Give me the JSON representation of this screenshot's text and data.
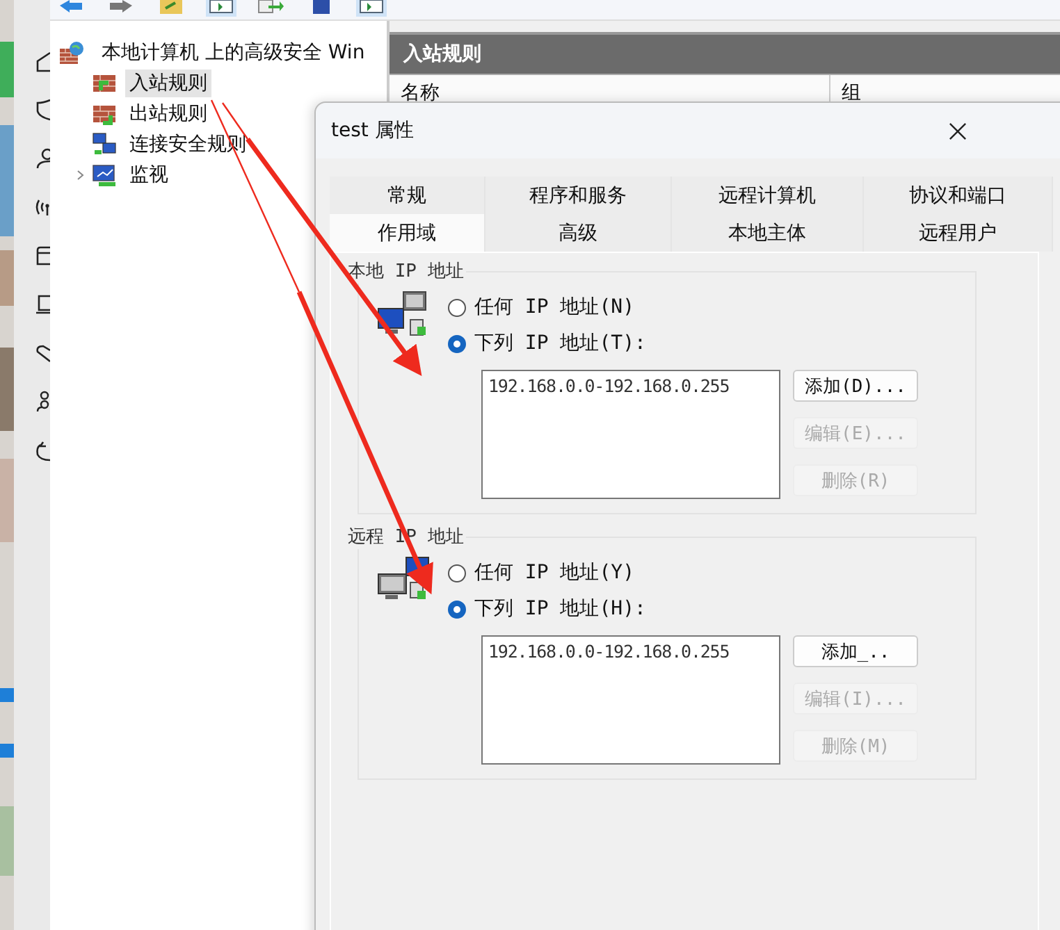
{
  "tree": {
    "label": "本地计算机 上的高级安全 Win",
    "children": [
      {
        "label": "入站规则",
        "kind": "inbound",
        "selected": true
      },
      {
        "label": "出站规则",
        "kind": "outbound",
        "selected": false
      },
      {
        "label": "连接安全规则",
        "kind": "connection",
        "selected": false
      },
      {
        "label": "监视",
        "kind": "monitor",
        "selected": false,
        "expanded": false
      }
    ]
  },
  "pane": {
    "title": "入站规则",
    "columns": [
      "名称",
      "组"
    ]
  },
  "dialog": {
    "title": "test 属性",
    "tabs": [
      [
        {
          "label": "常规",
          "selected": false
        },
        {
          "label": "程序和服务",
          "selected": false
        },
        {
          "label": "远程计算机",
          "selected": false
        },
        {
          "label": "协议和端口",
          "selected": false
        }
      ],
      [
        {
          "label": "作用域",
          "selected": true
        },
        {
          "label": "高级",
          "selected": false
        },
        {
          "label": "本地主体",
          "selected": false
        },
        {
          "label": "远程用户",
          "selected": false
        }
      ]
    ],
    "sections": [
      {
        "title": "本地 IP 地址",
        "kind": "local",
        "options": [
          {
            "label": "任何 IP 地址(N)",
            "selected": false
          },
          {
            "label": "下列 IP 地址(T):",
            "selected": true
          }
        ],
        "addresses": [
          "192.168.0.0-192.168.0.255"
        ],
        "buttons": [
          {
            "label": "添加(D)...",
            "disabled": false
          },
          {
            "label": "编辑(E)...",
            "disabled": true
          },
          {
            "label": "删除(R)",
            "disabled": true
          }
        ]
      },
      {
        "title": "远程 IP 地址",
        "kind": "remote",
        "options": [
          {
            "label": "任何 IP 地址(Y)",
            "selected": false
          },
          {
            "label": "下列 IP 地址(H):",
            "selected": true
          }
        ],
        "addresses": [
          "192.168.0.0-192.168.0.255"
        ],
        "buttons": [
          {
            "label": "添加_..",
            "disabled": false
          },
          {
            "label": "编辑(I)...",
            "disabled": true
          },
          {
            "label": "删除(M)",
            "disabled": true
          }
        ]
      }
    ]
  }
}
